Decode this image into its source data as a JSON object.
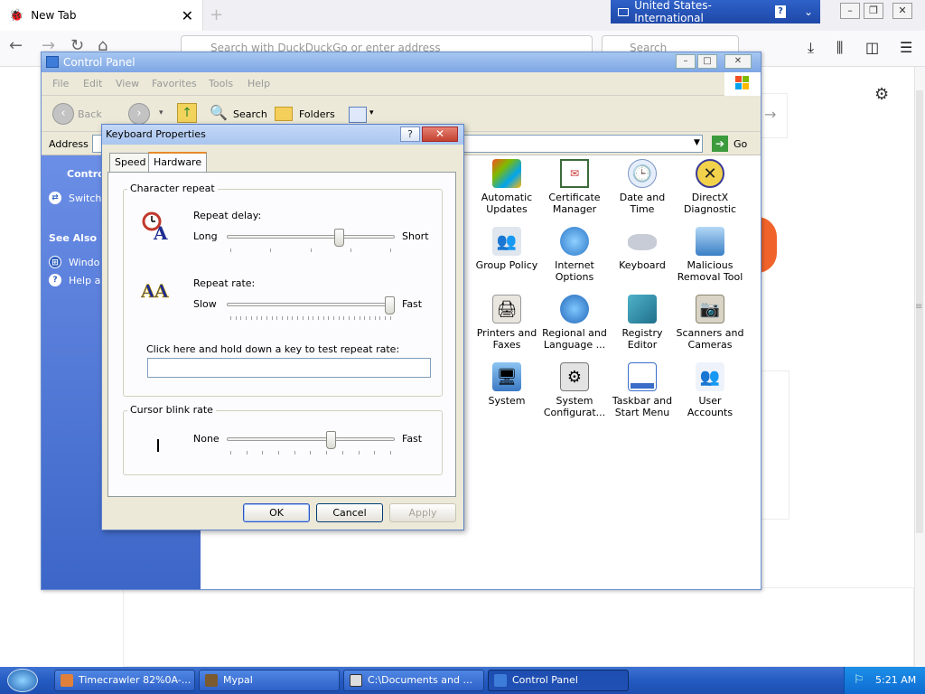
{
  "browser": {
    "tab_title": "New Tab",
    "tab_close": "✕",
    "new_tab": "+",
    "address_placeholder": "Search with DuckDuckGo or enter address",
    "search_placeholder": "Search"
  },
  "language_bar": {
    "label": "United States-International",
    "help": "?"
  },
  "control_panel": {
    "title": "Control Panel",
    "menu": [
      "File",
      "Edit",
      "View",
      "Favorites",
      "Tools",
      "Help"
    ],
    "toolbar": {
      "back": "Back",
      "search": "Search",
      "folders": "Folders"
    },
    "address_label": "Address",
    "go_label": "Go",
    "sidebar": {
      "heading": "Contro",
      "switch_link": "Switch",
      "see_also": "See Also",
      "windows_link": "Windo",
      "help_link": "Help ar"
    },
    "icons": [
      {
        "line1": "Automatic",
        "line2": "Updates"
      },
      {
        "line1": "Certificate",
        "line2": "Manager"
      },
      {
        "line1": "Date and",
        "line2": "Time"
      },
      {
        "line1": "DirectX",
        "line2": "Diagnostic"
      },
      {
        "line1": "Group Policy",
        "line2": ""
      },
      {
        "line1": "Internet",
        "line2": "Options"
      },
      {
        "line1": "Keyboard",
        "line2": ""
      },
      {
        "line1": "Malicious",
        "line2": "Removal Tool"
      },
      {
        "line1": "Printers and",
        "line2": "Faxes"
      },
      {
        "line1": "Regional and",
        "line2": "Language ..."
      },
      {
        "line1": "Registry",
        "line2": "Editor"
      },
      {
        "line1": "Scanners and",
        "line2": "Cameras"
      },
      {
        "line1": "System",
        "line2": ""
      },
      {
        "line1": "System",
        "line2": "Configurat..."
      },
      {
        "line1": "Taskbar and",
        "line2": "Start Menu"
      },
      {
        "line1": "User",
        "line2": "Accounts"
      }
    ]
  },
  "dialog": {
    "title": "Keyboard Properties",
    "help_btn": "?",
    "close_btn": "✕",
    "tabs": [
      "Speed",
      "Hardware"
    ],
    "character_repeat": {
      "group_label": "Character repeat",
      "repeat_delay_label": "Repeat delay:",
      "delay_min": "Long",
      "delay_max": "Short",
      "delay_value": 0.68,
      "repeat_rate_label": "Repeat rate:",
      "rate_min": "Slow",
      "rate_max": "Fast",
      "rate_value": 1.0,
      "test_label": "Click here and hold down a key to test repeat rate:"
    },
    "cursor_blink": {
      "group_label": "Cursor blink rate",
      "min": "None",
      "max": "Fast",
      "value": 0.63
    },
    "buttons": {
      "ok": "OK",
      "cancel": "Cancel",
      "apply": "Apply"
    }
  },
  "taskbar": {
    "items": [
      "Timecrawler 82%0A-...",
      "Mypal",
      "C:\\Documents and ...",
      "Control Panel"
    ],
    "clock": "5:21 AM"
  }
}
